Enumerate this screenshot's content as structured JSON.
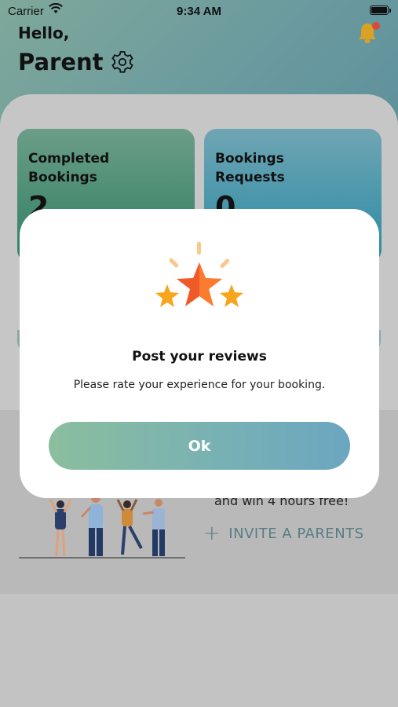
{
  "status_bar": {
    "carrier": "Carrier",
    "time": "9:34 AM"
  },
  "header": {
    "hello": "Hello,",
    "name": "Parent"
  },
  "stats": {
    "completed_label": "Completed\nBookings",
    "completed_value": "2",
    "requests_label": "Bookings\nRequests",
    "requests_value": "0"
  },
  "invite": {
    "text": "and win 4 hours free!",
    "button_label": "INVITE A PARENTS"
  },
  "modal": {
    "title": "Post your reviews",
    "description": "Please rate your experience for your booking.",
    "ok_label": "Ok"
  },
  "colors": {
    "accent_start": "#8bbe9e",
    "accent_end": "#6ba6c0",
    "notification_dot": "#d84a3a",
    "star_main": "#f05a28",
    "star_side": "#f7a51c"
  },
  "icons": [
    "wifi-icon",
    "battery-icon",
    "gear-icon",
    "bell-icon",
    "star-rating-icon",
    "plus-icon"
  ]
}
